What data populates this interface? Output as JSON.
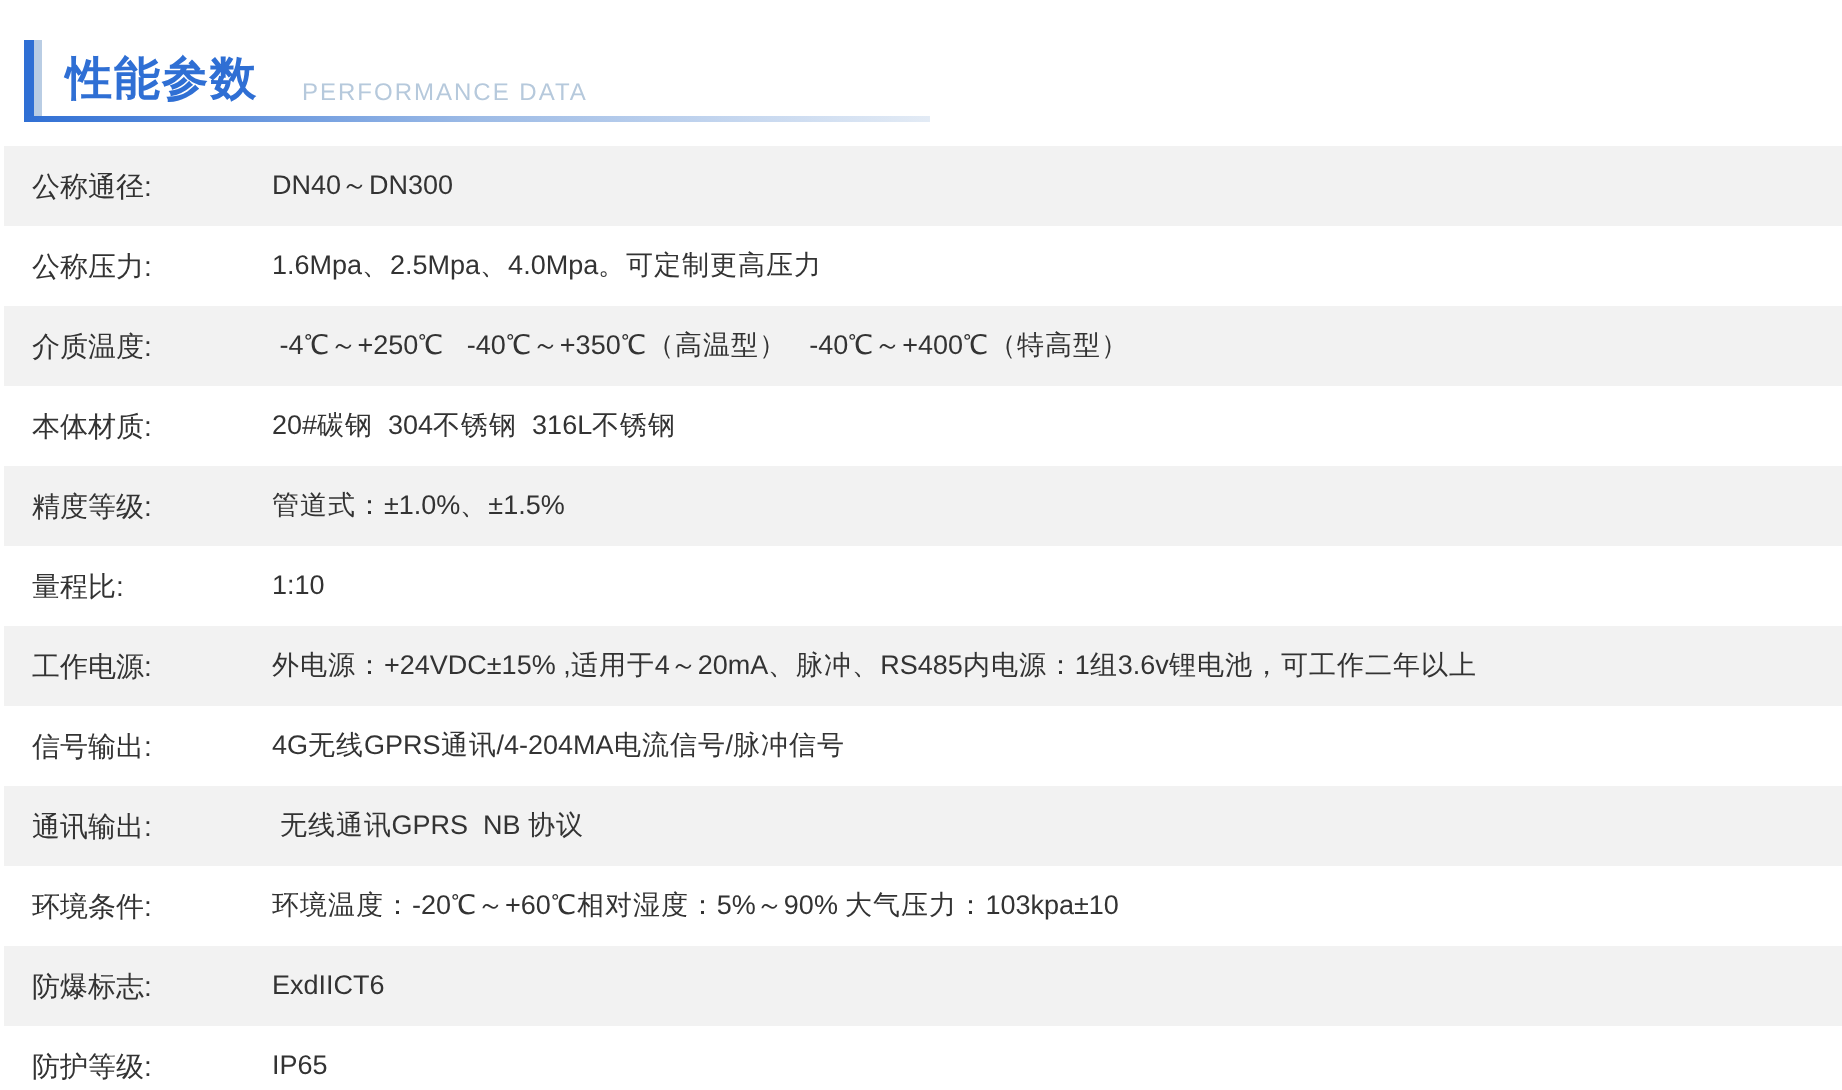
{
  "section": {
    "title": "性能参数",
    "subtitle": "PERFORMANCE DATA"
  },
  "rows": [
    {
      "label": "公称通径:",
      "value": "DN40～DN300"
    },
    {
      "label": "公称压力:",
      "value": "1.6Mpa、2.5Mpa、4.0Mpa。可定制更高压力"
    },
    {
      "label": "介质温度:",
      "value": " -4℃～+250℃   -40℃～+350℃（高温型）   -40℃～+400℃（特高型）"
    },
    {
      "label": "本体材质:",
      "value": "20#碳钢  304不锈钢  316L不锈钢"
    },
    {
      "label": "精度等级:",
      "value": "管道式：±1.0%、±1.5%"
    },
    {
      "label": "量程比:",
      "value": "1:10"
    },
    {
      "label": "工作电源:",
      "value": "外电源：+24VDC±15% ,适用于4～20mA、脉冲、RS485内电源：1组3.6v锂电池，可工作二年以上"
    },
    {
      "label": "信号输出:",
      "value": "4G无线GPRS通讯/4-204MA电流信号/脉冲信号"
    },
    {
      "label": "通讯输出:",
      "value": " 无线通讯GPRS  NB 协议"
    },
    {
      "label": "环境条件:",
      "value": "环境温度：-20℃～+60℃相对湿度：5%～90% 大气压力：103kpa±10"
    },
    {
      "label": "防爆标志:",
      "value": "ExdIICT6"
    },
    {
      "label": "防护等级:",
      "value": "IP65"
    }
  ]
}
